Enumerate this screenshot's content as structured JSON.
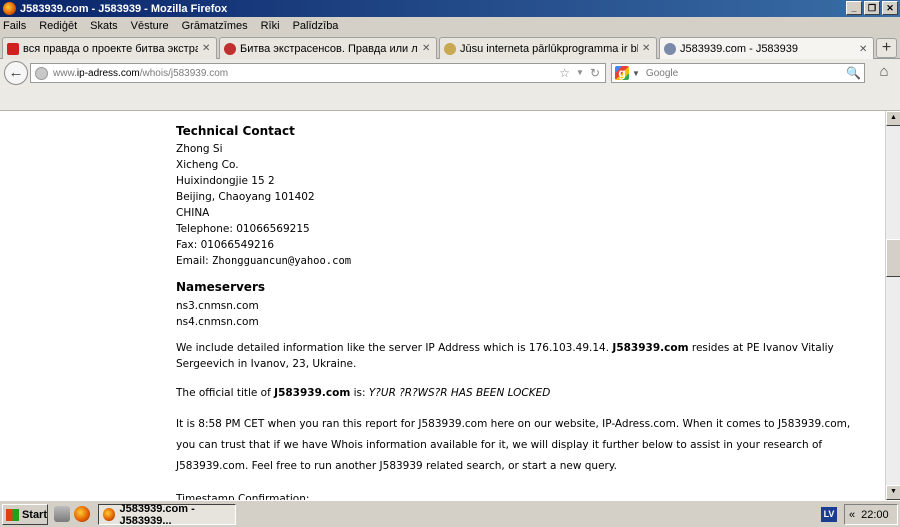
{
  "window": {
    "title": "J583939.com - J583939 - Mozilla Firefox",
    "buttons": [
      "_",
      "❐",
      "✕"
    ]
  },
  "menu": [
    "Fails",
    "Rediģēt",
    "Skats",
    "Vēsture",
    "Grāmatzīmes",
    "Rīki",
    "Palīdzība"
  ],
  "tabs": [
    {
      "label": "вся правда о проекте битва экстрасе...",
      "close": "✕",
      "icon_color": "#d02020"
    },
    {
      "label": "Битва экстрасенсов. Правда или ложь...",
      "close": "✕",
      "icon_color": "#c03030"
    },
    {
      "label": "Jūsu interneta pārlūkprogramma ir bloķēta",
      "close": "✕",
      "icon_color": "#c8a850"
    },
    {
      "label": "J583939.com - J583939",
      "close": "✕",
      "icon_color": "#7a8aa8"
    }
  ],
  "new_tab_label": "+",
  "nav": {
    "back": "←",
    "url_prefix": "www.",
    "url_domain": "ip-adress.com",
    "url_path": "/whois/j583939.com",
    "star": "☆",
    "dropdown": "▼",
    "reload": "↻",
    "search_engine_letter": "g",
    "search_drop": "▼",
    "search_placeholder": "Google",
    "search_icon": "🔍",
    "home": "⌂"
  },
  "page": {
    "tech_heading": "Technical Contact",
    "tech_lines": [
      "Zhong Si",
      "Xicheng Co.",
      "Huixindongjie 15 2",
      "Beijing, Chaoyang 101402",
      "CHINA",
      "Telephone: 01066569215",
      "Fax: 01066549216"
    ],
    "email_label": "Email:",
    "email_value": "Zhongguancun@yahoo.com",
    "ns_heading": "Nameservers",
    "ns": [
      "ns3.cnmsn.com",
      "ns4.cnmsn.com"
    ],
    "p1_a": "We include detailed information like the server IP Address which is 176.103.49.14. ",
    "p1_b": "J583939.com",
    "p1_c": " resides at PE Ivanov Vitaliy Sergeevich in Ivanov, 23, Ukraine.",
    "p2_a": "The official title of ",
    "p2_b": "J583939.com",
    "p2_c": " is: ",
    "p2_d": "Y?UR ?R?WS?R HAS BEEN LOCKED",
    "p3": "It is 8:58 PM CET when you ran this report for J583939.com here on our website, IP-Adress.com. When it comes to J583939.com, you can trust that if we have Whois information available for it, we will display it further below to assist in your research of J583939.com. Feel free to run another J583939 related search, or start a new query.",
    "p4": "Timestamp Confirmation:"
  },
  "scrollbar": {
    "up": "▲",
    "down": "▼"
  },
  "taskbar": {
    "start_label": "Start",
    "task_label": "J583939.com - J583939...",
    "lang": "LV",
    "tray_chevron": "«",
    "clock": "22:00"
  }
}
